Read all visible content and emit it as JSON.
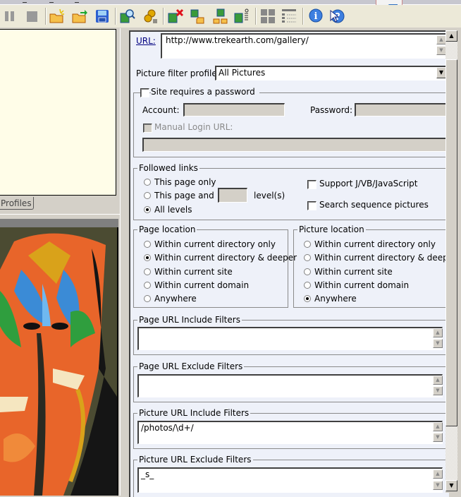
{
  "toolbar": {
    "buttons": [
      {
        "name": "pause",
        "icon": "pause-icon",
        "enabled": false
      },
      {
        "name": "stop",
        "icon": "stop-icon",
        "enabled": false
      },
      {
        "name": "new-project",
        "icon": "new-folder-icon",
        "enabled": true
      },
      {
        "name": "open-project",
        "icon": "open-folder-icon",
        "enabled": true
      },
      {
        "name": "save-project",
        "icon": "save-icon",
        "enabled": true
      },
      {
        "name": "find-pictures",
        "icon": "picture-search-icon",
        "enabled": true
      },
      {
        "name": "settings",
        "icon": "gears-icon",
        "enabled": true
      },
      {
        "name": "delete-picture",
        "icon": "picture-delete-icon",
        "enabled": true
      },
      {
        "name": "copy-to-folder",
        "icon": "picture-copy-icon",
        "enabled": true
      },
      {
        "name": "move-to-folders",
        "icon": "picture-move-icon",
        "enabled": true
      },
      {
        "name": "picture-details",
        "icon": "picture-details-icon",
        "enabled": true
      },
      {
        "name": "thumbnail-view",
        "icon": "thumbnails-icon",
        "enabled": true
      },
      {
        "name": "details-view",
        "icon": "list-view-icon",
        "enabled": true
      },
      {
        "name": "about",
        "icon": "info-icon",
        "enabled": true
      },
      {
        "name": "help",
        "icon": "help-icon",
        "enabled": true
      }
    ]
  },
  "left_panel": {
    "profiles_tab": "Profiles"
  },
  "form": {
    "url_label": "URL:",
    "url_value": "http://www.trekearth.com/gallery/",
    "filter_profile_label": "Picture filter profile:",
    "filter_profile_value": "All Pictures",
    "password_group": {
      "checkbox_label": "Site requires a password",
      "checked": false,
      "account_label": "Account:",
      "account_value": "",
      "password_label": "Password:",
      "password_value": "",
      "manual_login_label": "Manual Login URL:",
      "manual_login_checked": false,
      "manual_login_value": ""
    },
    "followed_links": {
      "title": "Followed links",
      "options": [
        "This page only",
        "This page and",
        "All levels"
      ],
      "selected": 2,
      "levels_value": "",
      "levels_suffix": "level(s)",
      "support_js_label": "Support J/VB/JavaScript",
      "support_js_checked": false,
      "search_sequence_label": "Search sequence pictures",
      "search_sequence_checked": false
    },
    "page_location": {
      "title": "Page location",
      "options": [
        "Within current directory only",
        "Within current directory & deeper",
        "Within current site",
        "Within current domain",
        "Anywhere"
      ],
      "selected": 1
    },
    "picture_location": {
      "title": "Picture location",
      "options": [
        "Within current directory only",
        "Within current directory & deeper",
        "Within current site",
        "Within current domain",
        "Anywhere"
      ],
      "selected": 4
    },
    "page_url_include": {
      "title": "Page URL Include Filters",
      "value": ""
    },
    "page_url_exclude": {
      "title": "Page URL Exclude Filters",
      "value": ""
    },
    "picture_url_include": {
      "title": "Picture URL Include Filters",
      "value": "/photos/\\d+/"
    },
    "picture_url_exclude": {
      "title": "Picture URL Exclude Filters",
      "value": "_s_"
    }
  },
  "icons": {
    "scroll_up": "▲",
    "scroll_down": "▼",
    "dropdown": "▼"
  }
}
